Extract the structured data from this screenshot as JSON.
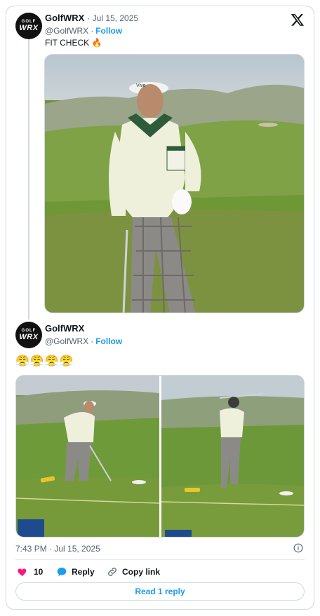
{
  "tweet1": {
    "avatar_text_top": "GOLF",
    "avatar_text_bottom": "WRX",
    "name": "GolfWRX",
    "date": "· Jul 15, 2025",
    "handle": "@GolfWRX",
    "dot": "·",
    "follow_label": "Follow",
    "text": "FIT CHECK 🔥",
    "visor_text": "Vive"
  },
  "tweet2": {
    "avatar_text_top": "GOLF",
    "avatar_text_bottom": "WRX",
    "name": "GolfWRX",
    "handle": "@GolfWRX",
    "dot": "·",
    "follow_label": "Follow",
    "text": "😤😤😤😤"
  },
  "meta": {
    "timestamp": "7:43 PM · Jul 15, 2025"
  },
  "actions": {
    "like_count": "10",
    "reply_label": "Reply",
    "copy_label": "Copy link"
  },
  "read_replies_label": "Read 1 reply",
  "colors": {
    "accent": "#1d9bf0",
    "like": "#f91880",
    "text": "#0f1419",
    "muted": "#536471",
    "border": "#cfd9de"
  },
  "icons": [
    "x-logo-icon",
    "heart-icon",
    "reply-bubble-icon",
    "link-icon",
    "info-icon"
  ]
}
